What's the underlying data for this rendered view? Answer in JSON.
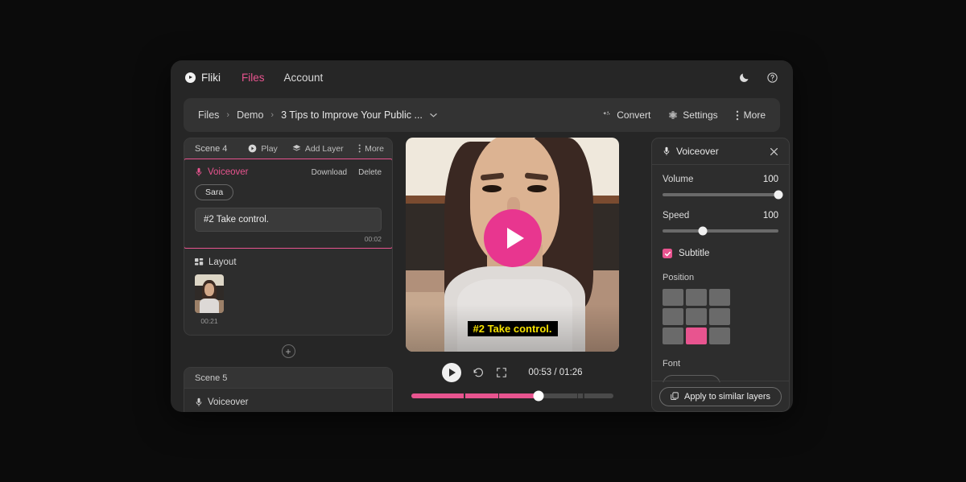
{
  "topnav": {
    "brand": "Fliki",
    "brand_icon": "play-circle-icon",
    "links": [
      {
        "label": "Files",
        "active": true
      },
      {
        "label": "Account",
        "active": false
      }
    ],
    "theme_icon": "moon-icon",
    "help_icon": "help-circle-icon"
  },
  "breadcrumb": {
    "items": [
      "Files",
      "Demo",
      "3 Tips to Improve Your Public ..."
    ],
    "separator": "›",
    "caret": "⌄",
    "actions": [
      {
        "label": "Convert",
        "icon": "sparkle-plus-icon"
      },
      {
        "label": "Settings",
        "icon": "gear-icon"
      },
      {
        "label": "More",
        "icon": "dots-vertical-icon"
      }
    ]
  },
  "scenes": [
    {
      "title": "Scene 4",
      "actions": [
        {
          "label": "Play",
          "icon": "play-circle-icon"
        },
        {
          "label": "Add Layer",
          "icon": "layers-icon"
        },
        {
          "label": "More",
          "icon": "dots-vertical-icon"
        }
      ],
      "voiceover": {
        "label": "Voiceover",
        "icon": "microphone-icon",
        "download": "Download",
        "delete": "Delete",
        "voice_name": "Sara",
        "text": "#2 Take control.",
        "duration": "00:02"
      },
      "layout": {
        "label": "Layout",
        "icon": "grid-icon",
        "clip_duration": "00:21"
      }
    },
    {
      "title": "Scene 5",
      "voiceover": {
        "label": "Voiceover",
        "icon": "microphone-icon"
      }
    }
  ],
  "add_scene_button": "+",
  "preview": {
    "subtitle": "#2 Take control.",
    "subtitle_color": "#f6e200",
    "subtitle_bg": "#000000",
    "play_overlay_icon": "play-icon",
    "play_overlay_color": "#e8368f"
  },
  "player": {
    "play_icon": "play-icon",
    "replay_icon": "rotate-ccw-icon",
    "fullscreen_icon": "expand-icon",
    "time_current": "00:53",
    "time_separator": "/",
    "time_total": "01:26",
    "time_display": "00:53 / 01:26",
    "progress_percent": 63,
    "progress_color": "#e8548f"
  },
  "right_panel": {
    "title": "Voiceover",
    "title_icon": "microphone-icon",
    "close_icon": "close-icon",
    "volume": {
      "label": "Volume",
      "value": "100",
      "percent": 100
    },
    "speed": {
      "label": "Speed",
      "value": "100",
      "percent": 28
    },
    "subtitle": {
      "label": "Subtitle",
      "checked": true,
      "check_icon": "check-icon"
    },
    "position": {
      "label": "Position",
      "selected_index": 7,
      "cells": 9
    },
    "font": {
      "label": "Font"
    },
    "apply_button": {
      "label": "Apply to similar layers",
      "icon": "copy-icon"
    }
  },
  "colors": {
    "accent_pink": "#e8548f",
    "accent_pink_strong": "#e8368f",
    "window_bg": "#262626",
    "panel_bg": "#2d2d2d",
    "page_bg": "#0b0b0b",
    "subtitle_yellow": "#f6e200"
  }
}
